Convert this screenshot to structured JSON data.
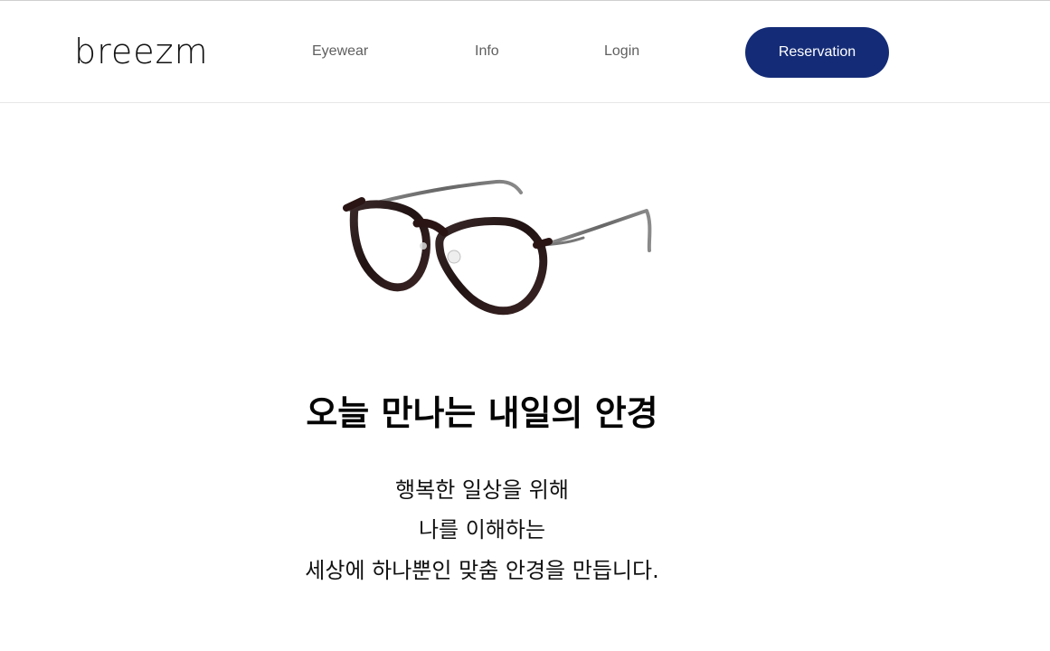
{
  "header": {
    "logo": "breezm",
    "nav": {
      "eyewear": "Eyewear",
      "info": "Info",
      "login": "Login"
    },
    "reservation": "Reservation"
  },
  "hero": {
    "headline": "오늘 만나는 내일의 안경",
    "copy": [
      "행복한 일상을 위해",
      "나를 이해하는",
      "세상에 하나뿐인 맞춤 안경을 만듭니다."
    ]
  },
  "colors": {
    "brand_navy": "#142c77",
    "nav_text": "#5f5f5f",
    "frame": "#2a1b1b",
    "temple": "#6f6f6f"
  },
  "icons": {
    "product": "glasses-icon"
  }
}
